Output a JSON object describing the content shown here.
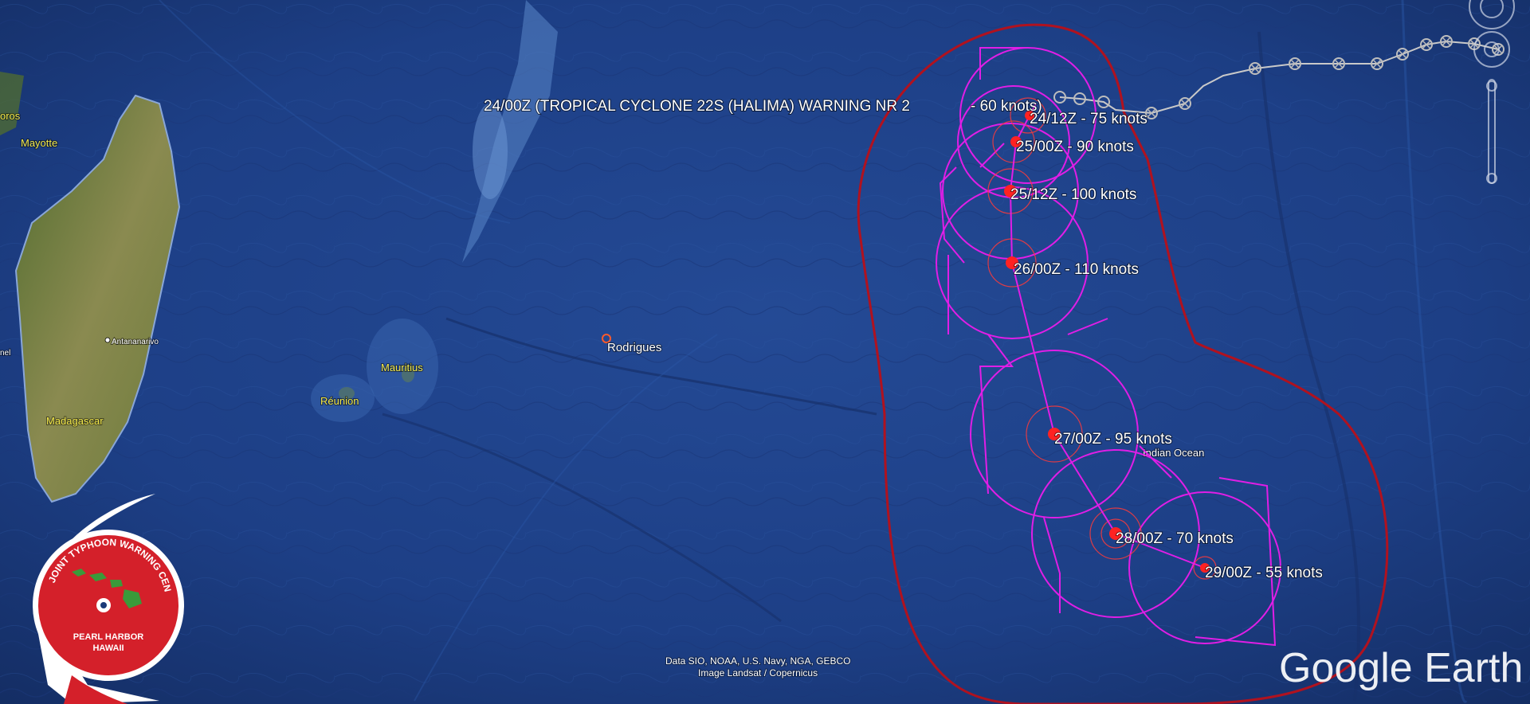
{
  "warning_title": "24/00Z (TROPICAL CYCLONE 22S (HALIMA) WARNING NR 2",
  "initial_intensity": "- 60 knots)",
  "forecast_points": [
    {
      "label": "24/12Z - 75 knots"
    },
    {
      "label": "25/00Z - 90 knots"
    },
    {
      "label": "25/12Z - 100 knots"
    },
    {
      "label": "26/00Z - 110 knots"
    },
    {
      "label": "27/00Z - 95 knots"
    },
    {
      "label": "28/00Z - 70 knots"
    },
    {
      "label": "29/00Z - 55 knots"
    }
  ],
  "places": {
    "comoros": "oros",
    "mayotte": "Mayotte",
    "antananarivo": "Antananarivo",
    "madagascar": "Madagascar",
    "mauritius": "Mauritius",
    "reunion": "Réunion",
    "rodrigues": "Rodrigues",
    "indian_ocean": "Indian Ocean",
    "edge_label": "nel"
  },
  "credits": {
    "line1": "Data SIO, NOAA, U.S. Navy, NGA, GEBCO",
    "line2": "Image Landsat / Copernicus"
  },
  "brand": "Google Earth",
  "jtwc_logo": {
    "top_text": "JOINT TYPHOON WARNING CENTER",
    "line1": "PEARL HARBOR",
    "line2": "HAWAII"
  },
  "colors": {
    "ocean": "#1b3a78",
    "danger_area": "#b0121f",
    "wind_radii": "#e01ee6",
    "track_point": "#ff2222",
    "past_track": "#c9c9c9",
    "land": "#6e7a3c"
  }
}
